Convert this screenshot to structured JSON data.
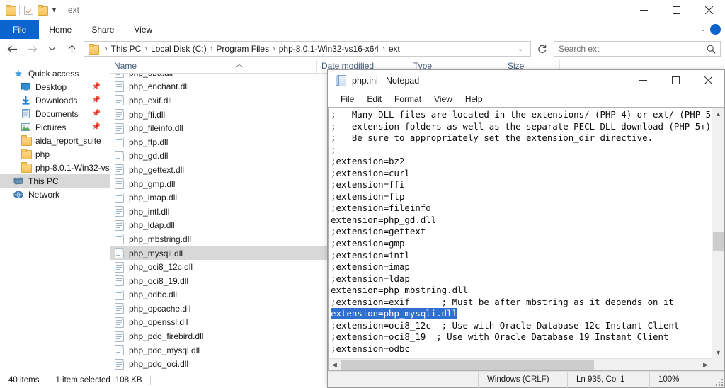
{
  "explorer": {
    "title": "ext",
    "quick_access_icons": [
      "folder-icon",
      "properties-icon",
      "new-folder-icon",
      "customize-caret-icon"
    ],
    "ribbon_tabs": [
      {
        "label": "File",
        "active": true
      },
      {
        "label": "Home",
        "active": false
      },
      {
        "label": "Share",
        "active": false
      },
      {
        "label": "View",
        "active": false
      }
    ],
    "window_controls": [
      "minimize",
      "maximize",
      "close"
    ],
    "address": {
      "crumbs": [
        "This PC",
        "Local Disk (C:)",
        "Program Files",
        "php-8.0.1-Win32-vs16-x64",
        "ext"
      ],
      "separator": "›"
    },
    "search": {
      "placeholder": "Search ext",
      "value": ""
    },
    "sidebar": [
      {
        "label": "Quick access",
        "icon": "star-icon",
        "pinned": false,
        "indent": false,
        "selected": false
      },
      {
        "label": "Desktop",
        "icon": "desktop-icon",
        "pinned": true,
        "indent": true,
        "selected": false
      },
      {
        "label": "Downloads",
        "icon": "download-icon",
        "pinned": true,
        "indent": true,
        "selected": false
      },
      {
        "label": "Documents",
        "icon": "documents-icon",
        "pinned": true,
        "indent": true,
        "selected": false
      },
      {
        "label": "Pictures",
        "icon": "pictures-icon",
        "pinned": true,
        "indent": true,
        "selected": false
      },
      {
        "label": "aida_report_suite",
        "icon": "folder-icon",
        "pinned": false,
        "indent": true,
        "selected": false
      },
      {
        "label": "php",
        "icon": "folder-icon",
        "pinned": false,
        "indent": true,
        "selected": false
      },
      {
        "label": "php-8.0.1-Win32-vs",
        "icon": "folder-icon",
        "pinned": false,
        "indent": true,
        "selected": false
      },
      {
        "label": "This PC",
        "icon": "thispc-icon",
        "pinned": false,
        "indent": false,
        "selected": true
      },
      {
        "label": "Network",
        "icon": "network-icon",
        "pinned": false,
        "indent": false,
        "selected": false
      }
    ],
    "columns": [
      "Name",
      "Date modified",
      "Type",
      "Size"
    ],
    "files": [
      {
        "name": "php_dba.dll",
        "selected": false
      },
      {
        "name": "php_enchant.dll",
        "selected": false
      },
      {
        "name": "php_exif.dll",
        "selected": false
      },
      {
        "name": "php_ffi.dll",
        "selected": false
      },
      {
        "name": "php_fileinfo.dll",
        "selected": false
      },
      {
        "name": "php_ftp.dll",
        "selected": false
      },
      {
        "name": "php_gd.dll",
        "selected": false
      },
      {
        "name": "php_gettext.dll",
        "selected": false
      },
      {
        "name": "php_gmp.dll",
        "selected": false
      },
      {
        "name": "php_imap.dll",
        "selected": false
      },
      {
        "name": "php_intl.dll",
        "selected": false
      },
      {
        "name": "php_ldap.dll",
        "selected": false
      },
      {
        "name": "php_mbstring.dll",
        "selected": false
      },
      {
        "name": "php_mysqli.dll",
        "selected": true
      },
      {
        "name": "php_oci8_12c.dll",
        "selected": false
      },
      {
        "name": "php_oci8_19.dll",
        "selected": false
      },
      {
        "name": "php_odbc.dll",
        "selected": false
      },
      {
        "name": "php_opcache.dll",
        "selected": false
      },
      {
        "name": "php_openssl.dll",
        "selected": false
      },
      {
        "name": "php_pdo_firebird.dll",
        "selected": false
      },
      {
        "name": "php_pdo_mysql.dll",
        "selected": false
      },
      {
        "name": "php_pdo_oci.dll",
        "selected": false
      }
    ],
    "status": {
      "item_count": "40 items",
      "selection": "1 item selected",
      "size": "108 KB"
    }
  },
  "notepad": {
    "title": "php.ini - Notepad",
    "menu": [
      "File",
      "Edit",
      "Format",
      "View",
      "Help"
    ],
    "window_controls": [
      "minimize",
      "maximize",
      "close"
    ],
    "lines": [
      {
        "text": "; - Many DLL files are located in the extensions/ (PHP 4) or ext/ (PHP 5",
        "highlight": false
      },
      {
        "text": ";   extension folders as well as the separate PECL DLL download (PHP 5+)",
        "highlight": false
      },
      {
        "text": ";   Be sure to appropriately set the extension_dir directive.",
        "highlight": false
      },
      {
        "text": ";",
        "highlight": false
      },
      {
        "text": ";extension=bz2",
        "highlight": false
      },
      {
        "text": ";extension=curl",
        "highlight": false
      },
      {
        "text": ";extension=ffi",
        "highlight": false
      },
      {
        "text": ";extension=ftp",
        "highlight": false
      },
      {
        "text": ";extension=fileinfo",
        "highlight": false
      },
      {
        "text": "extension=php_gd.dll",
        "highlight": false
      },
      {
        "text": ";extension=gettext",
        "highlight": false
      },
      {
        "text": ";extension=gmp",
        "highlight": false
      },
      {
        "text": ";extension=intl",
        "highlight": false
      },
      {
        "text": ";extension=imap",
        "highlight": false
      },
      {
        "text": ";extension=ldap",
        "highlight": false
      },
      {
        "text": "extension=php_mbstring.dll",
        "highlight": false
      },
      {
        "text": ";extension=exif      ; Must be after mbstring as it depends on it",
        "highlight": false
      },
      {
        "text": "extension=php_mysqli.dll",
        "highlight": true
      },
      {
        "text": ";extension=oci8_12c  ; Use with Oracle Database 12c Instant Client",
        "highlight": false
      },
      {
        "text": ";extension=oci8_19  ; Use with Oracle Database 19 Instant Client",
        "highlight": false
      },
      {
        "text": ";extension=odbc",
        "highlight": false
      }
    ],
    "status": {
      "encoding": "Windows (CRLF)",
      "position": "Ln 935, Col 1",
      "zoom": "100%"
    }
  },
  "colors": {
    "accent": "#0b63ce",
    "selection_blue": "#2f6fd0",
    "row_selected_gray": "#d8d8d8",
    "column_header_text": "#46607e"
  }
}
